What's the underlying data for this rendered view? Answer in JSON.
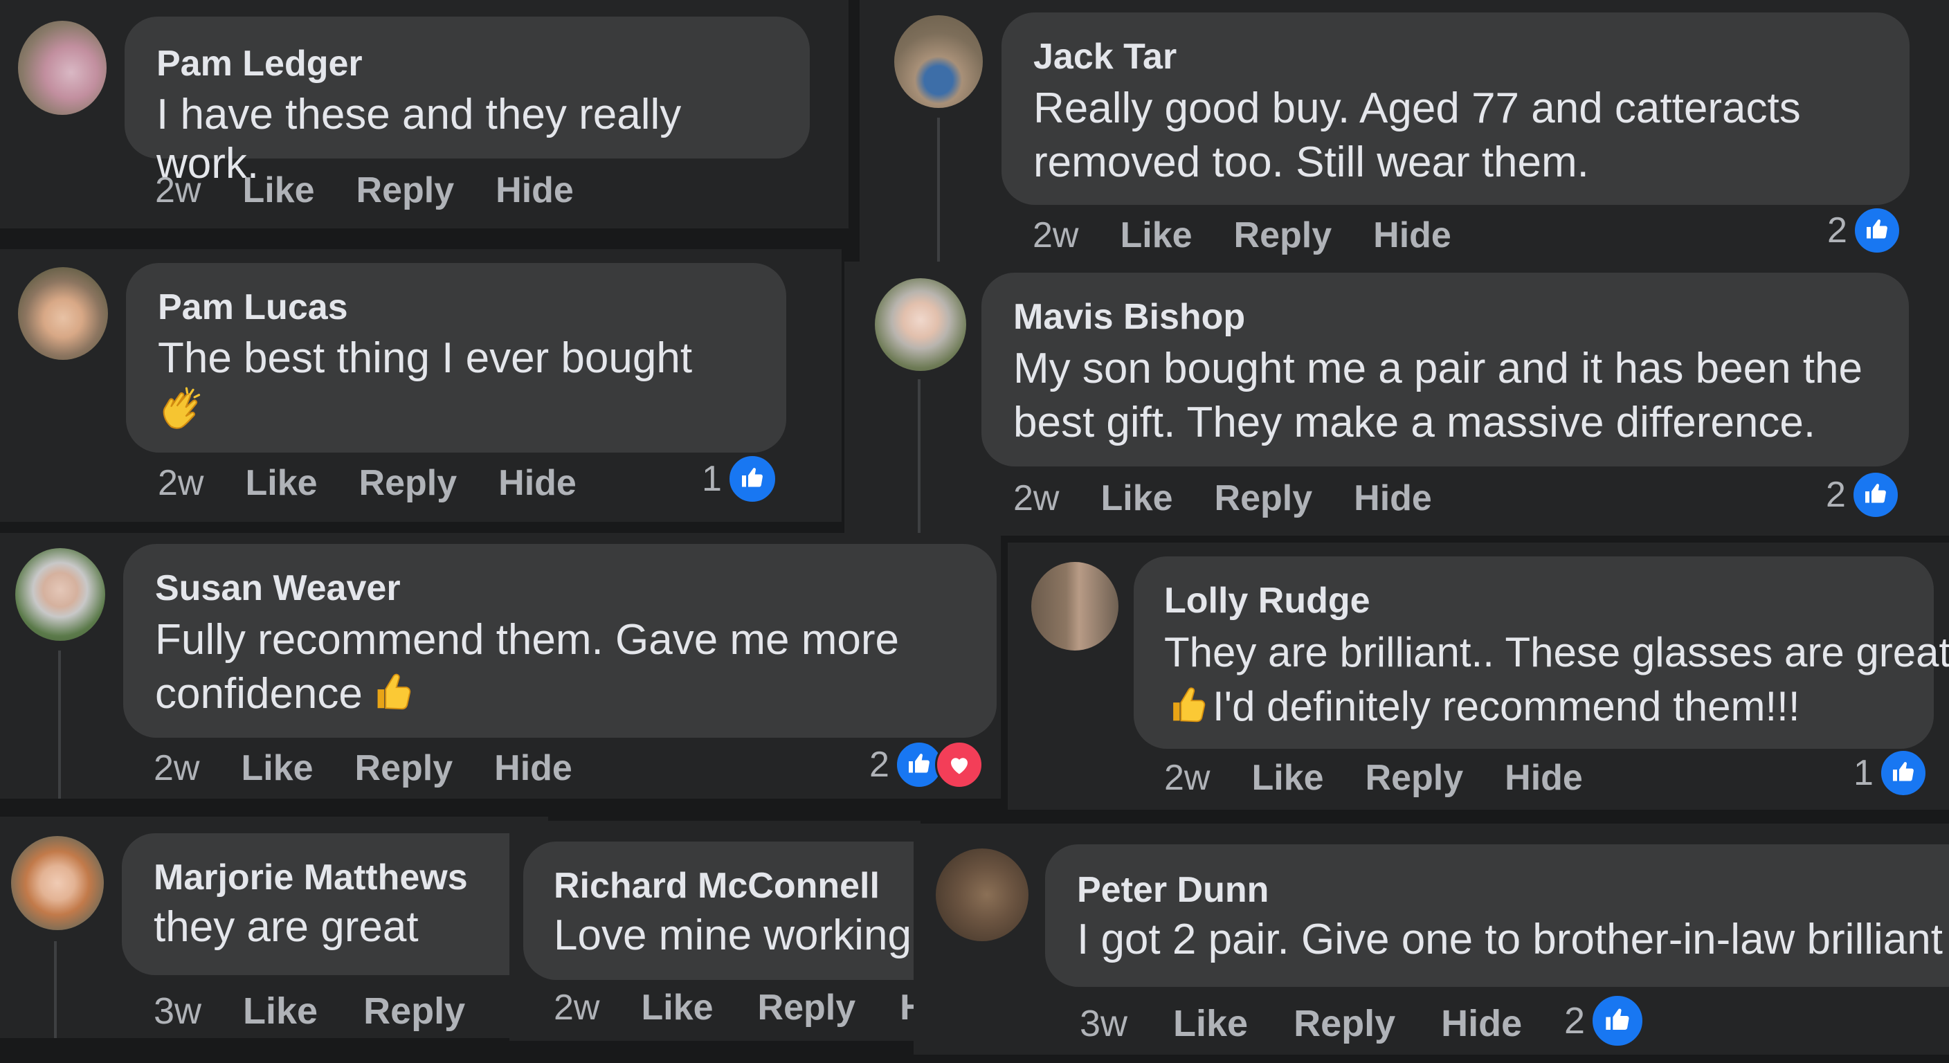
{
  "colors": {
    "page_background": "#18191a",
    "panel_background": "#242526",
    "bubble_background": "#3a3b3c",
    "primary_text": "#e4e6eb",
    "secondary_text": "#b0b3b8",
    "like_blue": "#1877f2",
    "love_red": "#f33e58"
  },
  "comments": [
    {
      "author": "Pam Ledger",
      "text": "I have these and they really work.",
      "time": "2w",
      "actions": [
        "Like",
        "Reply",
        "Hide"
      ]
    },
    {
      "author": "Jack Tar",
      "text": "Really good buy. Aged 77 and catteracts\nremoved too. Still wear them.",
      "time": "2w",
      "actions": [
        "Like",
        "Reply",
        "Hide"
      ],
      "reaction_count": "2",
      "reactions": [
        "like-icon"
      ]
    },
    {
      "author": "Pam Lucas",
      "text": "The best thing I ever bought",
      "emoji": "clapping-hands-emoji",
      "time": "2w",
      "actions": [
        "Like",
        "Reply",
        "Hide"
      ],
      "reaction_count": "1",
      "reactions": [
        "like-icon"
      ]
    },
    {
      "author": "Mavis Bishop",
      "text": "My son bought me a pair and it has been the\nbest gift. They make a massive difference.",
      "time": "2w",
      "actions": [
        "Like",
        "Reply",
        "Hide"
      ],
      "reaction_count": "2",
      "reactions": [
        "like-icon"
      ]
    },
    {
      "author": "Susan Weaver",
      "text": "Fully recommend them. Gave me more\nconfidence",
      "emoji": "thumbs-up-emoji",
      "time": "2w",
      "actions": [
        "Like",
        "Reply",
        "Hide"
      ],
      "reaction_count": "2",
      "reactions": [
        "like-icon",
        "love-icon"
      ]
    },
    {
      "author": "Lolly Rudge",
      "text_line1": "They are brilliant.. These glasses are great",
      "text_line2": "I'd definitely recommend them!!!",
      "emoji": "thumbs-up-emoji",
      "time": "2w",
      "actions": [
        "Like",
        "Reply",
        "Hide"
      ],
      "reaction_count": "1",
      "reactions": [
        "like-icon"
      ]
    },
    {
      "author": "Marjorie Matthews",
      "text": "they are great",
      "time": "3w",
      "actions": [
        "Like",
        "Reply"
      ]
    },
    {
      "author": "Richard McConnell",
      "text": "Love mine working",
      "time": "2w",
      "actions": [
        "Like",
        "Reply",
        "H"
      ]
    },
    {
      "author": "Peter Dunn",
      "text": "I got 2 pair. Give one to brother-in-law brilliant",
      "time": "3w",
      "actions": [
        "Like",
        "Reply",
        "Hide"
      ],
      "reaction_count": "2",
      "reactions": [
        "like-icon"
      ]
    }
  ]
}
